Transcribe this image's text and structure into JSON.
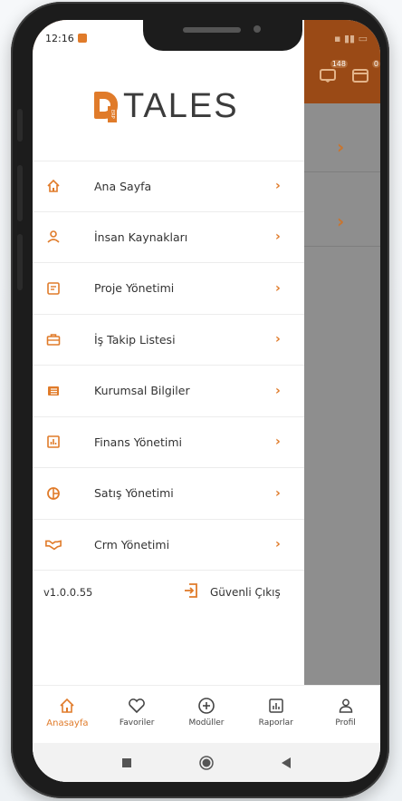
{
  "status_bar": {
    "time": "12:16"
  },
  "logo": {
    "text": "TALES",
    "mark": "ERP"
  },
  "menu": {
    "items": [
      {
        "label": "Ana Sayfa",
        "icon": "home-icon"
      },
      {
        "label": "İnsan Kaynakları",
        "icon": "person-icon"
      },
      {
        "label": "Proje Yönetimi",
        "icon": "document-icon"
      },
      {
        "label": "İş Takip Listesi",
        "icon": "briefcase-icon"
      },
      {
        "label": "Kurumsal Bilgiler",
        "icon": "list-icon"
      },
      {
        "label": "Finans Yönetimi",
        "icon": "chart-icon"
      },
      {
        "label": "Satış Yönetimi",
        "icon": "pie-chart-icon"
      },
      {
        "label": "Crm Yönetimi",
        "icon": "handshake-icon"
      }
    ]
  },
  "footer": {
    "version": "v1.0.0.55",
    "logout_label": "Güvenli Çıkış"
  },
  "app_header": {
    "badge_left": "148",
    "badge_right": "0"
  },
  "tabbar": {
    "tabs": [
      {
        "label": "Anasayfa",
        "active": true
      },
      {
        "label": "Favoriler",
        "active": false
      },
      {
        "label": "Modüller",
        "active": false
      },
      {
        "label": "Raporlar",
        "active": false
      },
      {
        "label": "Profil",
        "active": false
      }
    ]
  },
  "colors": {
    "accent": "#e07b2a",
    "header": "#9a4a16"
  }
}
